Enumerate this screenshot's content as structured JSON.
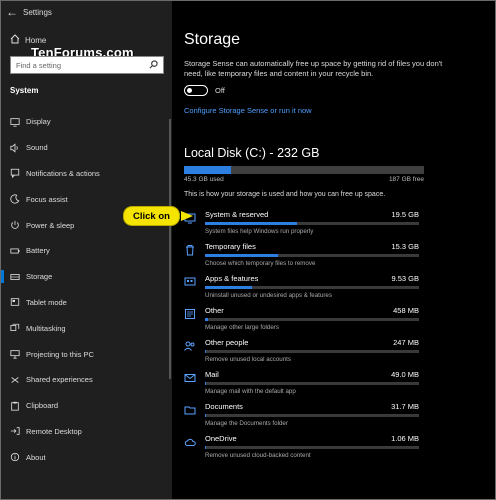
{
  "window": {
    "title": "Settings"
  },
  "watermark": "TenForums.com",
  "sidebar": {
    "home_label": "Home",
    "search_placeholder": "Find a setting",
    "section_title": "System",
    "items": [
      {
        "label": "Display",
        "icon": "display-icon",
        "active": false
      },
      {
        "label": "Sound",
        "icon": "sound-icon",
        "active": false
      },
      {
        "label": "Notifications & actions",
        "icon": "notifications-icon",
        "active": false
      },
      {
        "label": "Focus assist",
        "icon": "moon-icon",
        "active": false
      },
      {
        "label": "Power & sleep",
        "icon": "power-icon",
        "active": false
      },
      {
        "label": "Battery",
        "icon": "battery-icon",
        "active": false
      },
      {
        "label": "Storage",
        "icon": "storage-icon",
        "active": true
      },
      {
        "label": "Tablet mode",
        "icon": "tablet-icon",
        "active": false
      },
      {
        "label": "Multitasking",
        "icon": "multitasking-icon",
        "active": false
      },
      {
        "label": "Projecting to this PC",
        "icon": "projecting-icon",
        "active": false
      },
      {
        "label": "Shared experiences",
        "icon": "shared-icon",
        "active": false
      },
      {
        "label": "Clipboard",
        "icon": "clipboard-icon",
        "active": false
      },
      {
        "label": "Remote Desktop",
        "icon": "remote-desktop-icon",
        "active": false
      },
      {
        "label": "About",
        "icon": "info-icon",
        "active": false
      }
    ]
  },
  "main": {
    "title": "Storage",
    "sense_description": "Storage Sense can automatically free up space by getting rid of files you don't need, like temporary files and content in your recycle bin.",
    "toggle_label": "Off",
    "toggle_on": false,
    "configure_link": "Configure Storage Sense or run it now",
    "disk": {
      "title": "Local Disk (C:) - 232 GB",
      "used_label": "45.3 GB used",
      "free_label": "187 GB free",
      "used_fraction": 0.195
    },
    "usage_description": "This is how your storage is used and how you can free up space.",
    "categories": [
      {
        "name": "System & reserved",
        "size": "19.5 GB",
        "desc": "System files help Windows run properly",
        "icon": "system-icon",
        "fraction": 0.43
      },
      {
        "name": "Temporary files",
        "size": "15.3 GB",
        "desc": "Choose which temporary files to remove",
        "icon": "trash-icon",
        "fraction": 0.34
      },
      {
        "name": "Apps & features",
        "size": "9.53 GB",
        "desc": "Uninstall unused or undesired apps & features",
        "icon": "apps-icon",
        "fraction": 0.22
      },
      {
        "name": "Other",
        "size": "458 MB",
        "desc": "Manage other large folders",
        "icon": "other-icon",
        "fraction": 0.012
      },
      {
        "name": "Other people",
        "size": "247 MB",
        "desc": "Remove unused local accounts",
        "icon": "people-icon",
        "fraction": 0.007
      },
      {
        "name": "Mail",
        "size": "49.0 MB",
        "desc": "Manage mail with the default app",
        "icon": "mail-icon",
        "fraction": 0.003
      },
      {
        "name": "Documents",
        "size": "31.7 MB",
        "desc": "Manage the Documents folder",
        "icon": "documents-icon",
        "fraction": 0.002
      },
      {
        "name": "OneDrive",
        "size": "1.06 MB",
        "desc": "Remove unused cloud-backed content",
        "icon": "cloud-icon",
        "fraction": 0.001
      }
    ]
  },
  "callout": {
    "label": "Click on"
  },
  "colors": {
    "accent": "#0078d7",
    "bar": "#2c7fe0",
    "link": "#4ea0ff",
    "callout": "#f5e400"
  }
}
